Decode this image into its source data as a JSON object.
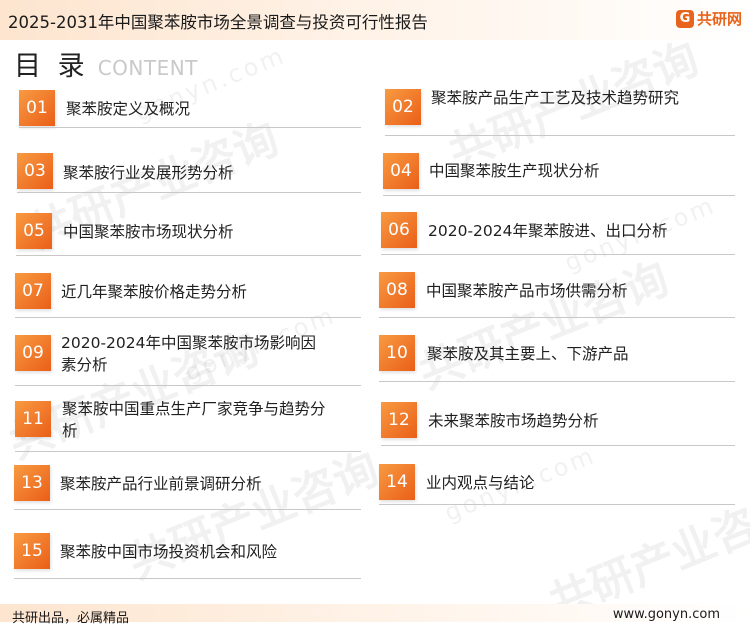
{
  "header": {
    "title": "2025-2031年中国聚苯胺市场全景调查与投资可行性报告",
    "brand": {
      "icon_letter": "G",
      "name": "共研网"
    }
  },
  "heading": {
    "main": "目 录",
    "sub": "CONTENT"
  },
  "watermark": {
    "text": "共研产业咨询",
    "url": "gonyn.com"
  },
  "items": [
    {
      "num": "01",
      "label": "聚苯胺定义及概况"
    },
    {
      "num": "02",
      "label": "聚苯胺产品生产工艺及技术趋势研究"
    },
    {
      "num": "03",
      "label": "聚苯胺行业发展形势分析"
    },
    {
      "num": "04",
      "label": "中国聚苯胺生产现状分析"
    },
    {
      "num": "05",
      "label": "中国聚苯胺市场现状分析"
    },
    {
      "num": "06",
      "label": "2020-2024年聚苯胺进、出口分析"
    },
    {
      "num": "07",
      "label": "近几年聚苯胺价格走势分析"
    },
    {
      "num": "08",
      "label": "中国聚苯胺产品市场供需分析"
    },
    {
      "num": "09",
      "label": "2020-2024年中国聚苯胺市场影响因素分析"
    },
    {
      "num": "10",
      "label": "聚苯胺及其主要上、下游产品"
    },
    {
      "num": "11",
      "label": "聚苯胺中国重点生产厂家竞争与趋势分析"
    },
    {
      "num": "12",
      "label": "未来聚苯胺市场趋势分析"
    },
    {
      "num": "13",
      "label": "聚苯胺产品行业前景调研分析"
    },
    {
      "num": "14",
      "label": "业内观点与结论"
    },
    {
      "num": "15",
      "label": "聚苯胺中国市场投资机会和风险"
    }
  ],
  "footer": {
    "slogan": "共研出品，必属精品",
    "url": "www.gonyn.com"
  },
  "colors": {
    "accent": "#ea5f18",
    "accent_light": "#f89a42"
  }
}
